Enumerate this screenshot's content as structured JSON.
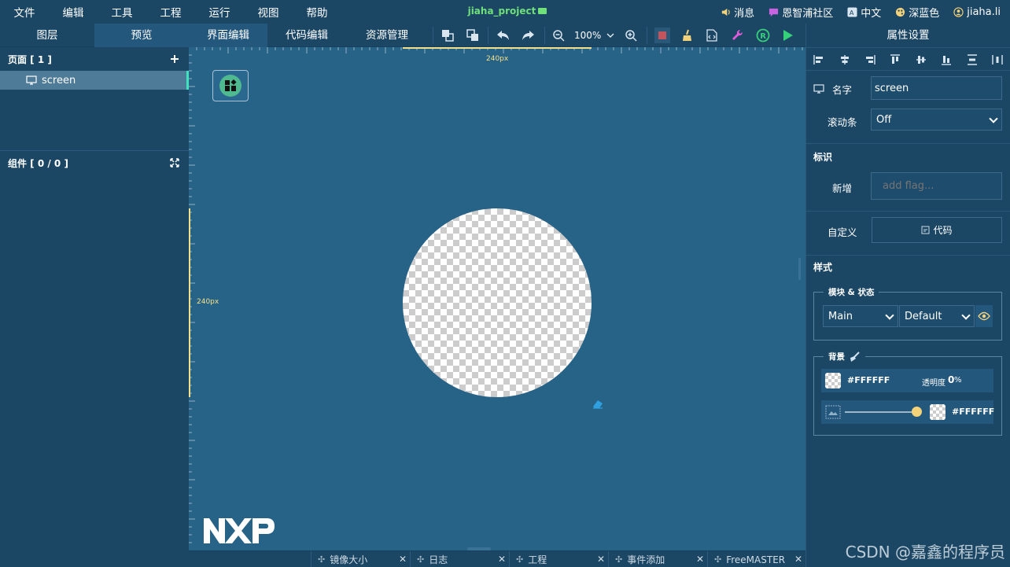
{
  "menubar": {
    "items": [
      "文件",
      "编辑",
      "工具",
      "工程",
      "运行",
      "视图",
      "帮助"
    ],
    "project_title": "jiaha_project",
    "right": {
      "messages": "消息",
      "community": "恩智浦社区",
      "language": "中文",
      "theme": "深蓝色",
      "user": "jiaha.li"
    }
  },
  "toolbar": {
    "left_tabs": [
      "图层",
      "预览"
    ],
    "editor_tabs": [
      "界面编辑",
      "代码编辑",
      "资源管理"
    ],
    "zoom": "100%"
  },
  "left_panel": {
    "pages_header": "页面 [ 1 ]",
    "page_item": "screen",
    "components_header": "组件 [ 0 / 0 ]"
  },
  "canvas": {
    "ruler_top_label": "240px",
    "ruler_left_label": "240px"
  },
  "bottom_tabs": [
    "镜像大小",
    "日志",
    "工程",
    "事件添加",
    "FreeMASTER"
  ],
  "properties": {
    "title": "属性设置",
    "name_label": "名字",
    "name_value": "screen",
    "scrollbar_label": "滚动条",
    "scrollbar_value": "Off",
    "flags_title": "标识",
    "add_label": "新增",
    "add_placeholder": "add flag...",
    "custom_label": "自定义",
    "code_button": "代码",
    "style_title": "样式",
    "part_state_legend": "模块 & 状态",
    "part_value": "Main",
    "state_value": "Default",
    "background_legend": "背景",
    "bg_color": "#FFFFFF",
    "opacity_label": "透明度",
    "opacity_value": "0",
    "opacity_unit": "%",
    "image_recolor": "#FFFFFF"
  },
  "colors": {
    "accent_green": "#3fe3c0",
    "ruler_label": "#f3e08a",
    "project_title": "#6fe07a"
  },
  "watermark": "CSDN @嘉鑫的程序员"
}
